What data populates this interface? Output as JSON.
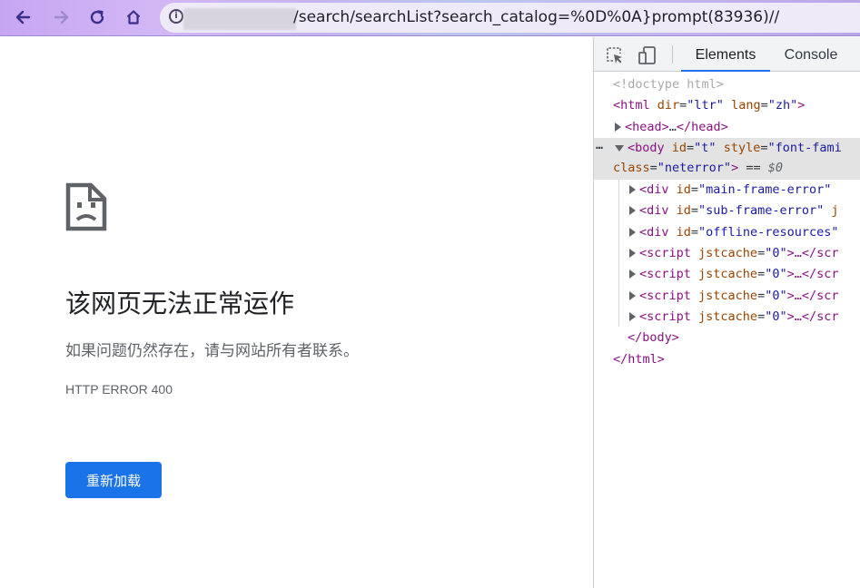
{
  "browser": {
    "url_visible": "/search/searchList?search_catalog=%0D%0A}prompt(83936)//",
    "info_icon": "i"
  },
  "page": {
    "title": "该网页无法正常运作",
    "subtitle": "如果问题仍然存在，请与网站所有者联系。",
    "error_code": "HTTP ERROR 400",
    "reload_label": "重新加载"
  },
  "devtools": {
    "tabs": [
      "Elements",
      "Console"
    ],
    "active_tab": "Elements",
    "lines": [
      {
        "t1": "<!doctype html>"
      },
      {
        "open": "<html",
        "a1": " dir",
        "v1": "\"ltr\"",
        "a2": " lang",
        "v2": "\"zh\"",
        "close": ">"
      },
      {
        "open": "<head>",
        "mid": "…",
        "close": "</head>"
      },
      {
        "open": "<body",
        "a1": " id",
        "v1": "\"t\"",
        "a2": " style",
        "v2": "\"font-fami"
      },
      {
        "a1": "class",
        "v1": "\"neterror\"",
        "close": ">",
        "eq": " == ",
        "dim": "$0"
      },
      {
        "open": "<div",
        "a1": " id",
        "v1": "\"main-frame-error\""
      },
      {
        "open": "<div",
        "a1": " id",
        "v1": "\"sub-frame-error\"",
        "tail": " j"
      },
      {
        "open": "<div",
        "a1": " id",
        "v1": "\"offline-resources\""
      },
      {
        "open": "<script",
        "a1": " jstcache",
        "v1": "\"0\"",
        "close": ">…</scr"
      },
      {
        "open": "<script",
        "a1": " jstcache",
        "v1": "\"0\"",
        "close": ">…</scr"
      },
      {
        "open": "<script",
        "a1": " jstcache",
        "v1": "\"0\"",
        "close": ">…</scr"
      },
      {
        "open": "<script",
        "a1": " jstcache",
        "v1": "\"0\"",
        "close": ">…</scr"
      },
      {
        "t1": "</body>"
      },
      {
        "t1": "</html>"
      }
    ]
  }
}
